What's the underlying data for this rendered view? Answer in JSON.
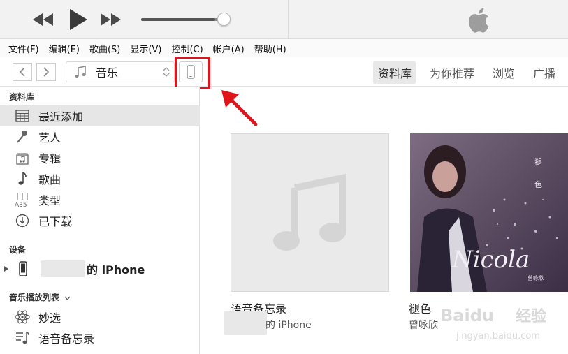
{
  "player": {
    "volume": 0.9,
    "icons": [
      "rewind-icon",
      "play-icon",
      "fast-forward-icon",
      "apple-logo"
    ]
  },
  "menu": [
    "文件(F)",
    "编辑(E)",
    "歌曲(S)",
    "显示(V)",
    "控制(C)",
    "帐户(A)",
    "帮助(H)"
  ],
  "toolbar": {
    "media_kind": "音乐",
    "tabs": [
      "资料库",
      "为你推荐",
      "浏览",
      "广播"
    ],
    "active_tab": "资料库"
  },
  "sidebar": {
    "library_header": "资料库",
    "library_items": [
      "最近添加",
      "艺人",
      "专辑",
      "歌曲",
      "类型",
      "已下载"
    ],
    "selected_item": "最近添加",
    "devices_header": "设备",
    "device_name_suffix": "的 iPhone",
    "playlists_header": "音乐播放列表",
    "playlist_items": [
      "妙选",
      "语音备忘录"
    ]
  },
  "albums": [
    {
      "title": "语音备忘录",
      "subtitle": "的 iPhone"
    },
    {
      "title": "褪色",
      "subtitle": "曾咏欣",
      "cover_text": "Nicola",
      "cover_vertical": "褪 色",
      "cover_artist": "曾咏欣"
    }
  ],
  "watermark": {
    "brand": "Baidu",
    "cn": "经验",
    "url": "jingyan.baidu.com"
  },
  "colors": {
    "highlight_red": "#e0151b",
    "selected_row": "#e6e6e6",
    "placeholder_note": "#d5d5d5"
  }
}
